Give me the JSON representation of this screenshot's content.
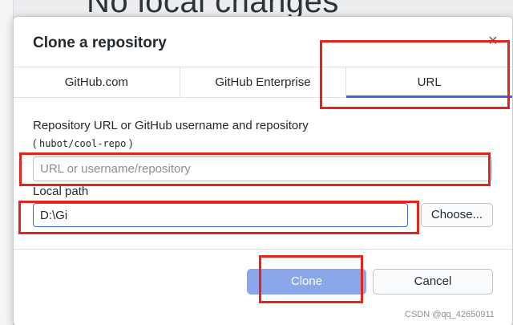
{
  "background": {
    "title": "No local changes"
  },
  "dialog": {
    "title": "Clone a repository",
    "close_symbol": "×",
    "tabs": [
      {
        "label": "GitHub.com",
        "active": false
      },
      {
        "label": "GitHub Enterprise",
        "active": false
      },
      {
        "label": "URL",
        "active": true
      }
    ],
    "url_field": {
      "label": "Repository URL or GitHub username and repository",
      "hint_prefix": "(",
      "hint_code": "hubot/cool-repo",
      "hint_suffix": ")",
      "placeholder": "URL or username/repository",
      "value": ""
    },
    "local_path": {
      "label": "Local path",
      "value": "D:\\Gi",
      "choose_label": "Choose..."
    },
    "buttons": {
      "clone_label": "Clone",
      "cancel_label": "Cancel"
    }
  },
  "watermark": "CSDN @qq_42650911",
  "colors": {
    "accent": "#3b6bd6",
    "clone_button_bg": "#8aa7ea",
    "annotation_red": "#e3241b"
  }
}
